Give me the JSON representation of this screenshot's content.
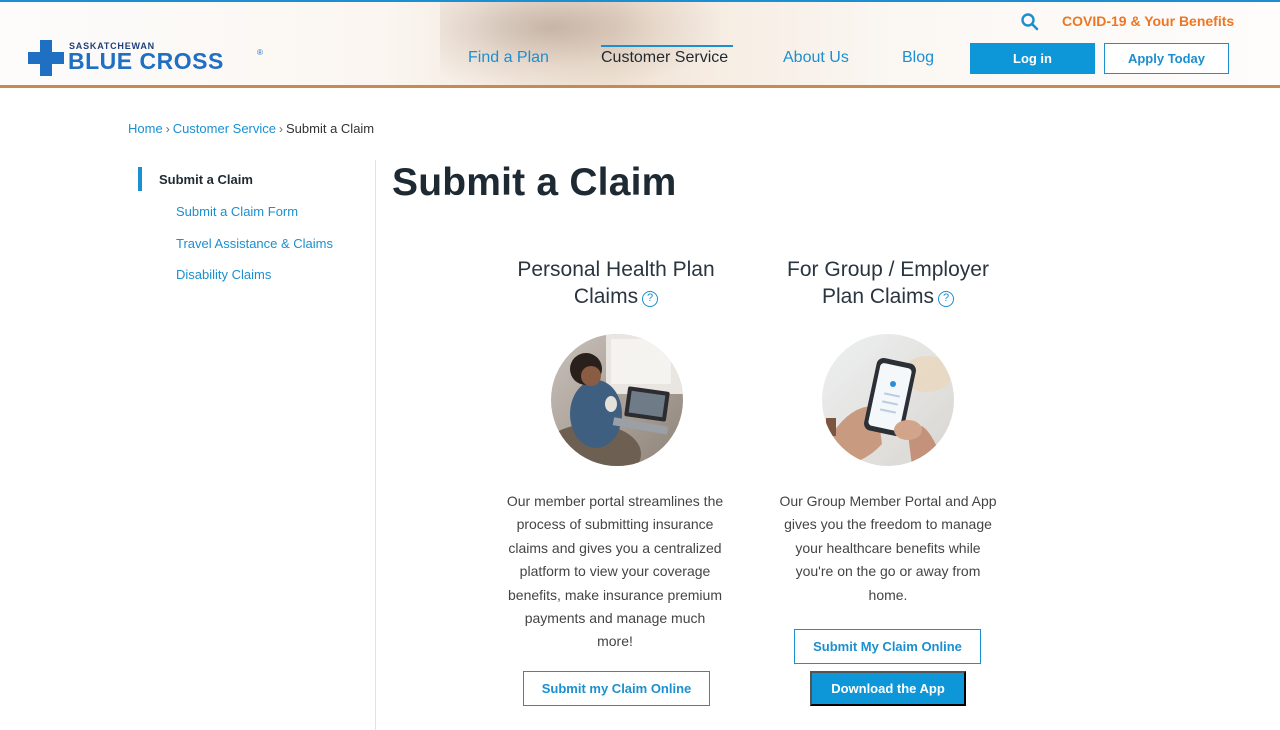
{
  "header": {
    "logo_small": "SASKATCHEWAN",
    "logo_big": "BLUE CROSS",
    "logo_reg": "®",
    "covid_link": "COVID-19 & Your Benefits",
    "nav": [
      "Find a Plan",
      "Customer Service",
      "About Us",
      "Blog"
    ],
    "active_nav": "Customer Service",
    "login_label": "Log in",
    "apply_label": "Apply Today"
  },
  "breadcrumb": {
    "items": [
      "Home",
      "Customer Service",
      "Submit a Claim"
    ],
    "separator": "›"
  },
  "sidebar": {
    "current": "Submit a Claim",
    "links": [
      "Submit a Claim Form",
      "Travel Assistance & Claims",
      "Disability Claims"
    ]
  },
  "main": {
    "title": "Submit a Claim",
    "columns": [
      {
        "title_line1": "Personal Health Plan",
        "title_line2": "Claims",
        "help": "?",
        "image": "woman-with-laptop-photo",
        "text_lines": [
          "Our member portal streamlines the",
          "process of submitting insurance",
          "claims and gives you a centralized",
          "platform to view your coverage",
          "benefits, make insurance premium",
          "payments and manage much",
          "more!"
        ],
        "button": "Submit my Claim Online"
      },
      {
        "title_line1": "For Group / Employer",
        "title_line2": "Plan Claims",
        "help": "?",
        "image": "hands-with-phone-photo",
        "text_lines": [
          "Our Group Member Portal and App",
          "gives you the freedom to manage",
          "your healthcare benefits while",
          "you're on the go or away from",
          "home."
        ],
        "button_outline": "Submit My Claim Online",
        "button_solid": "Download the App"
      }
    ]
  },
  "colors": {
    "brand_blue": "#1b8fd0",
    "logo_blue": "#1f6fc2",
    "button_blue": "#0d97d8",
    "accent_orange": "#ee7623",
    "heading": "#1e2a33"
  }
}
